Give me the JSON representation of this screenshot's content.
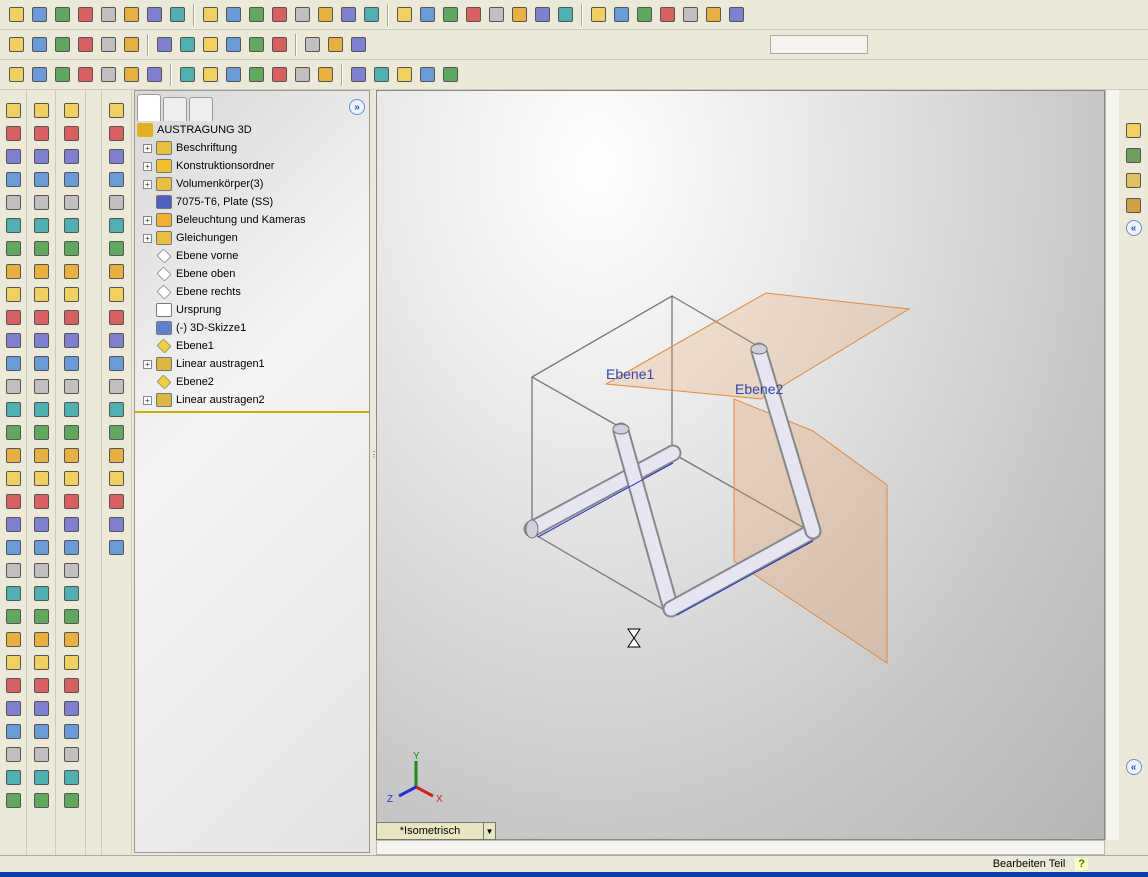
{
  "toolbars": {
    "row1": [
      "new",
      "open",
      "save",
      "print-preview",
      "print",
      "undo",
      "redo",
      "select",
      "rebuild",
      "options",
      "help",
      "camera",
      "sketch",
      "line",
      "point",
      "smart-dim",
      "record",
      "zoom-fit",
      "zoom-area",
      "zoom-in",
      "zoom-out",
      "rotate",
      "pan",
      "view-orient",
      "display-style",
      "wireframe",
      "hidden-lines",
      "shaded",
      "shaded-edges",
      "section",
      "appearance"
    ],
    "row2": [
      "play",
      "stop",
      "record-macro",
      "macro-new",
      "macro-edit",
      "close",
      "checkmark",
      "feature",
      "tool",
      "add-in",
      "measure",
      "mass",
      "sim",
      "photo",
      "render"
    ],
    "row3": [
      "spell",
      "dimension",
      "tolerance",
      "note",
      "balloon",
      "sum",
      "hole-callout",
      "table",
      "weld",
      "surface-finish",
      "datum",
      "geom-tol",
      "center-mark",
      "centerline",
      "hatch",
      "block",
      "revision",
      "weld-bead",
      "annotation"
    ],
    "config_select": ""
  },
  "tree": {
    "root": "AUSTRAGUNG 3D",
    "items": [
      {
        "label": "Beschriftung",
        "expand": true,
        "icon": "annotation-folder",
        "color": "#e8c040"
      },
      {
        "label": "Konstruktionsordner",
        "expand": true,
        "icon": "design-binder",
        "color": "#f0c030"
      },
      {
        "label": "Volumenkörper(3)",
        "expand": true,
        "icon": "solid-bodies-folder",
        "color": "#e8c040"
      },
      {
        "label": "7075-T6, Plate (SS)",
        "expand": false,
        "icon": "material",
        "color": "#5060c0"
      },
      {
        "label": "Beleuchtung und Kameras",
        "expand": true,
        "icon": "lights-folder",
        "color": "#f0b030"
      },
      {
        "label": "Gleichungen",
        "expand": true,
        "icon": "equations-folder",
        "color": "#e8c040"
      },
      {
        "label": "Ebene vorne",
        "expand": false,
        "icon": "plane",
        "color": "#ffffff"
      },
      {
        "label": "Ebene oben",
        "expand": false,
        "icon": "plane",
        "color": "#ffffff"
      },
      {
        "label": "Ebene rechts",
        "expand": false,
        "icon": "plane",
        "color": "#ffffff"
      },
      {
        "label": "Ursprung",
        "expand": false,
        "icon": "origin",
        "color": "#ffffff"
      },
      {
        "label": "(-) 3D-Skizze1",
        "expand": false,
        "icon": "3d-sketch",
        "color": "#6080d0"
      },
      {
        "label": "Ebene1",
        "expand": false,
        "icon": "plane-ref",
        "color": "#f0d040"
      },
      {
        "label": "Linear austragen1",
        "expand": true,
        "icon": "extrude",
        "color": "#d8b840"
      },
      {
        "label": "Ebene2",
        "expand": false,
        "icon": "plane-ref",
        "color": "#f0d040"
      },
      {
        "label": "Linear austragen2",
        "expand": true,
        "icon": "extrude",
        "color": "#d8b840"
      }
    ]
  },
  "viewport": {
    "plane1_label": "Ebene1",
    "plane2_label": "Ebene2",
    "triad": {
      "x": "X",
      "y": "Y",
      "z": "Z"
    },
    "view_orientation": "*Isometrisch"
  },
  "status": {
    "mode": "Bearbeiten Teil",
    "help": "?"
  },
  "colors": {
    "plane": "#e9a060",
    "tube": "#dcdcee",
    "accent": "#0a3ea8"
  }
}
